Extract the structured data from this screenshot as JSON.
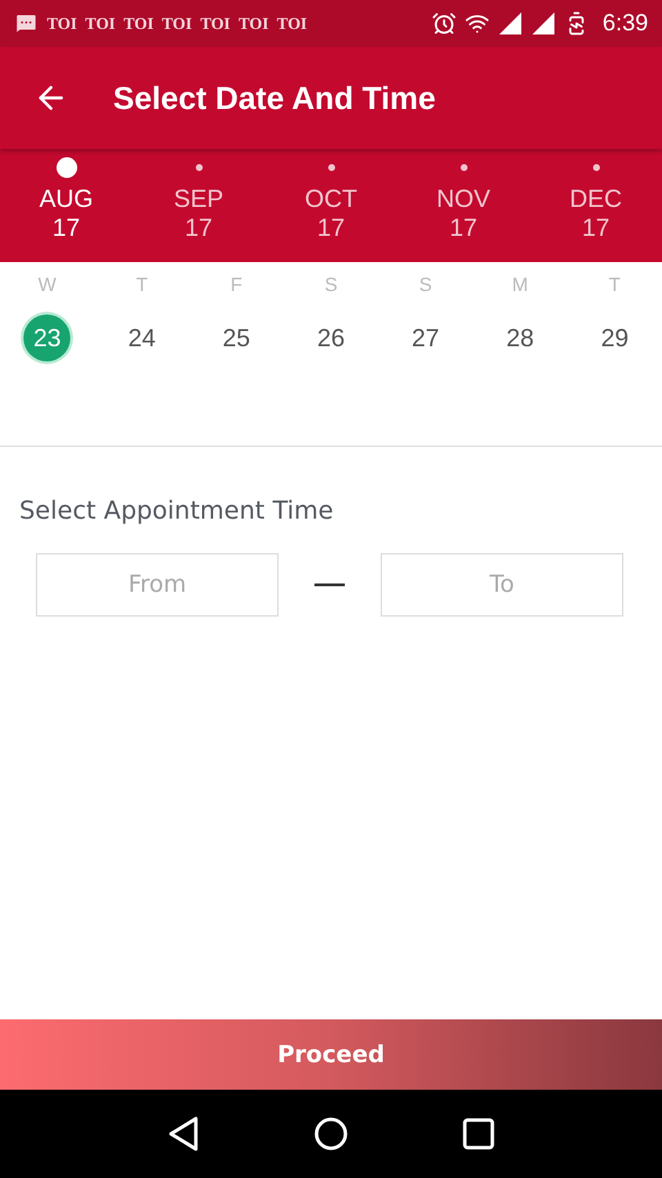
{
  "status_bar": {
    "notifications": [
      "TOI",
      "TOI",
      "TOI",
      "TOI",
      "TOI",
      "TOI",
      "TOI"
    ],
    "time": "6:39"
  },
  "toolbar": {
    "title": "Select Date And Time"
  },
  "months": [
    {
      "month": "AUG",
      "year": "17",
      "selected": true
    },
    {
      "month": "SEP",
      "year": "17",
      "selected": false
    },
    {
      "month": "OCT",
      "year": "17",
      "selected": false
    },
    {
      "month": "NOV",
      "year": "17",
      "selected": false
    },
    {
      "month": "DEC",
      "year": "17",
      "selected": false
    }
  ],
  "days": [
    {
      "weekday": "W",
      "date": "23",
      "selected": true
    },
    {
      "weekday": "T",
      "date": "24",
      "selected": false
    },
    {
      "weekday": "F",
      "date": "25",
      "selected": false
    },
    {
      "weekday": "S",
      "date": "26",
      "selected": false
    },
    {
      "weekday": "S",
      "date": "27",
      "selected": false
    },
    {
      "weekday": "M",
      "date": "28",
      "selected": false
    },
    {
      "weekday": "T",
      "date": "29",
      "selected": false
    }
  ],
  "time_section": {
    "heading": "Select Appointment Time",
    "from": {
      "placeholder": "From"
    },
    "to": {
      "placeholder": "To"
    }
  },
  "proceed_button": "Proceed"
}
